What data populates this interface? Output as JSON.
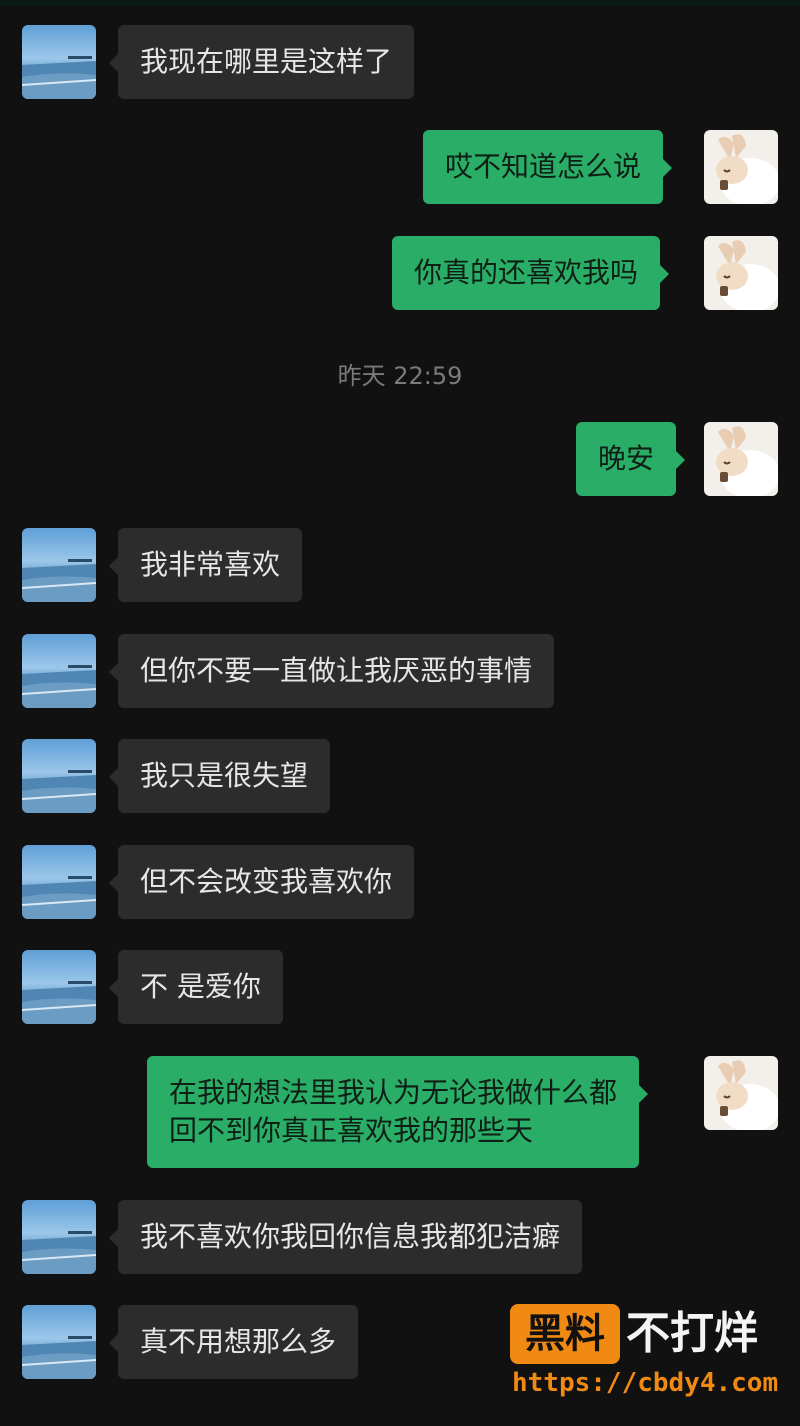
{
  "chat": {
    "timestamp": "昨天 22:59",
    "messages": [
      {
        "side": "in",
        "text": "我现在哪里是这样了"
      },
      {
        "side": "out",
        "text": "哎不知道怎么说"
      },
      {
        "side": "out",
        "text": "你真的还喜欢我吗"
      },
      {
        "side": "out",
        "text": "晚安"
      },
      {
        "side": "in",
        "text": "我非常喜欢"
      },
      {
        "side": "in",
        "text": "但你不要一直做让我厌恶的事情"
      },
      {
        "side": "in",
        "text": "我只是很失望"
      },
      {
        "side": "in",
        "text": "但不会改变我喜欢你"
      },
      {
        "side": "in",
        "text": "不 是爱你"
      },
      {
        "side": "out",
        "lines": [
          "在我的想法里我认为无论我做什么都",
          "回不到你真正喜欢我的那些天"
        ]
      },
      {
        "side": "in",
        "text": "我不喜欢你我回你信息我都犯洁癖"
      },
      {
        "side": "in",
        "text": "真不用想那么多"
      }
    ]
  },
  "watermark": {
    "badge": "黑料",
    "title": "不打烊",
    "url": "https://cbdy4.com"
  },
  "colors": {
    "background": "#111111",
    "incoming_bubble": "#2c2c2c",
    "outgoing_bubble": "#2aae67",
    "watermark_accent": "#f08a12"
  },
  "icons": {
    "incoming_avatar": "seascape-avatar-icon",
    "outgoing_avatar": "bunny-avatar-icon"
  }
}
